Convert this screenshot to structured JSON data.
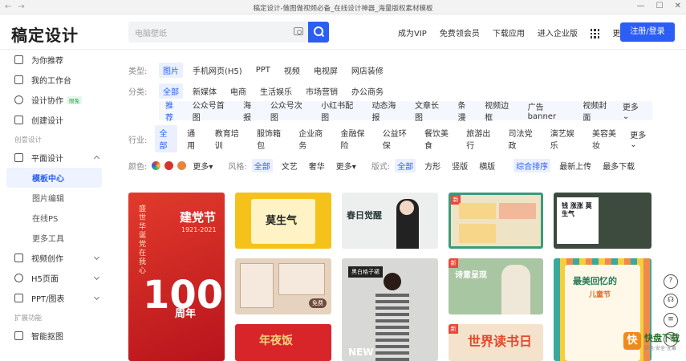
{
  "window": {
    "title": "稿定设计-做图做视频必备_在线设计神器_海量版权素材模板",
    "back": "←",
    "forward": "→",
    "minimize": "—",
    "maximize": "☐",
    "close": "✕"
  },
  "header": {
    "logo": "稿定设计",
    "search_placeholder": "电脑壁纸",
    "nav": [
      "成为VIP",
      "免费领会员",
      "下载应用",
      "进入企业版"
    ],
    "more": "更多",
    "login": "注册/登录"
  },
  "sidebar": {
    "items": [
      {
        "label": "为你推荐"
      },
      {
        "label": "我的工作台"
      },
      {
        "label": "设计协作",
        "badge": "限免"
      },
      {
        "label": "创建设计"
      }
    ],
    "section1": "创意设计",
    "design": "平面设计",
    "sub": [
      "模板中心",
      "图片编辑",
      "在线PS",
      "更多工具"
    ],
    "items2": [
      "视频创作",
      "H5页面",
      "PPT/图表"
    ],
    "section2": "扩展功能",
    "partial": "智能抠图"
  },
  "filters": {
    "type_label": "类型:",
    "types": [
      "图片",
      "手机网页(H5)",
      "PPT",
      "视频",
      "电视屏",
      "网店装修"
    ],
    "cat_label": "分类:",
    "cats": [
      "全部",
      "新媒体",
      "电商",
      "生活娱乐",
      "市场营销",
      "办公商务"
    ],
    "subcats": [
      "推荐",
      "公众号首图",
      "海报",
      "公众号次图",
      "小红书配图",
      "动态海报",
      "文章长图",
      "条漫",
      "视频边框",
      "广告banner",
      "视频封面"
    ],
    "subcat_more": "更多",
    "ind_label": "行业:",
    "inds": [
      "全部",
      "通用",
      "教育培训",
      "服饰箱包",
      "企业商务",
      "金融保险",
      "公益环保",
      "餐饮美食",
      "旅游出行",
      "司法党政",
      "演艺娱乐",
      "美容美妆"
    ],
    "ind_more": "更多"
  },
  "sortbar": {
    "color_label": "颜色:",
    "colors": [
      "#e0402b",
      "#d4342c",
      "#e9843c"
    ],
    "color_more": "更多",
    "style_label": "风格:",
    "styles": [
      "全部",
      "文艺",
      "奢华"
    ],
    "style_more": "更多",
    "layout_label": "版式:",
    "layouts": [
      "全部",
      "方形",
      "竖版",
      "横版"
    ],
    "sorts": [
      "综合排序",
      "最新上传",
      "最多下载"
    ]
  },
  "cards": {
    "c1_title": "建党节",
    "c1_years": "1921-2021",
    "c1_poem": "盛世华诞 党在我心",
    "c1_num": "100",
    "c1_unit": "周年",
    "c2_title": "莫生气",
    "c4_title": "春日觉醒",
    "c7_title": "诗意呈现",
    "c8_title": "最美回忆的",
    "c8_sub": "儿童节",
    "c9_title": "年夜饭",
    "c10_title": "NEW",
    "c11_title": "世界读书日",
    "c6_badge": "免费",
    "c5_title": "钱 涨涨 莫生气",
    "c10_sub": "黑白格子裙",
    "new_badge": "新"
  },
  "floatbar": [
    "?",
    "☊",
    "≡",
    "⇩"
  ],
  "watermark": {
    "text": "快盘下载",
    "sub": "绿色·安全·无毒"
  }
}
